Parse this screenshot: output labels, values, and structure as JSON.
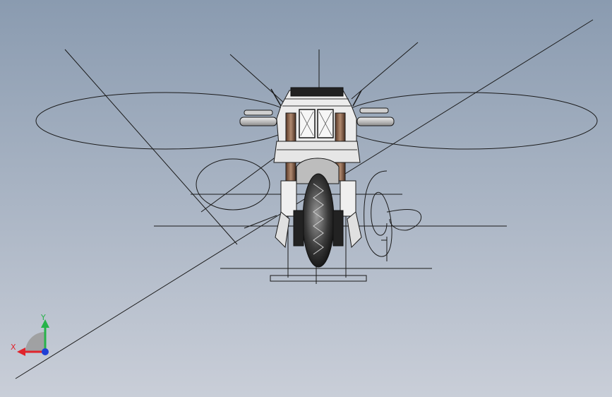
{
  "viewport": {
    "background_top": "#8a9bb0",
    "background_bottom": "#c9ced8",
    "line_color": "#1a1a1a",
    "model_name": "motorcycle-front-view",
    "view": "front"
  },
  "triad": {
    "x_label": "X",
    "y_label": "Y",
    "x_color": "#e0242c",
    "y_color": "#27b34a",
    "z_color": "#1f3fd6",
    "icon": "coordinate-triad-icon"
  }
}
